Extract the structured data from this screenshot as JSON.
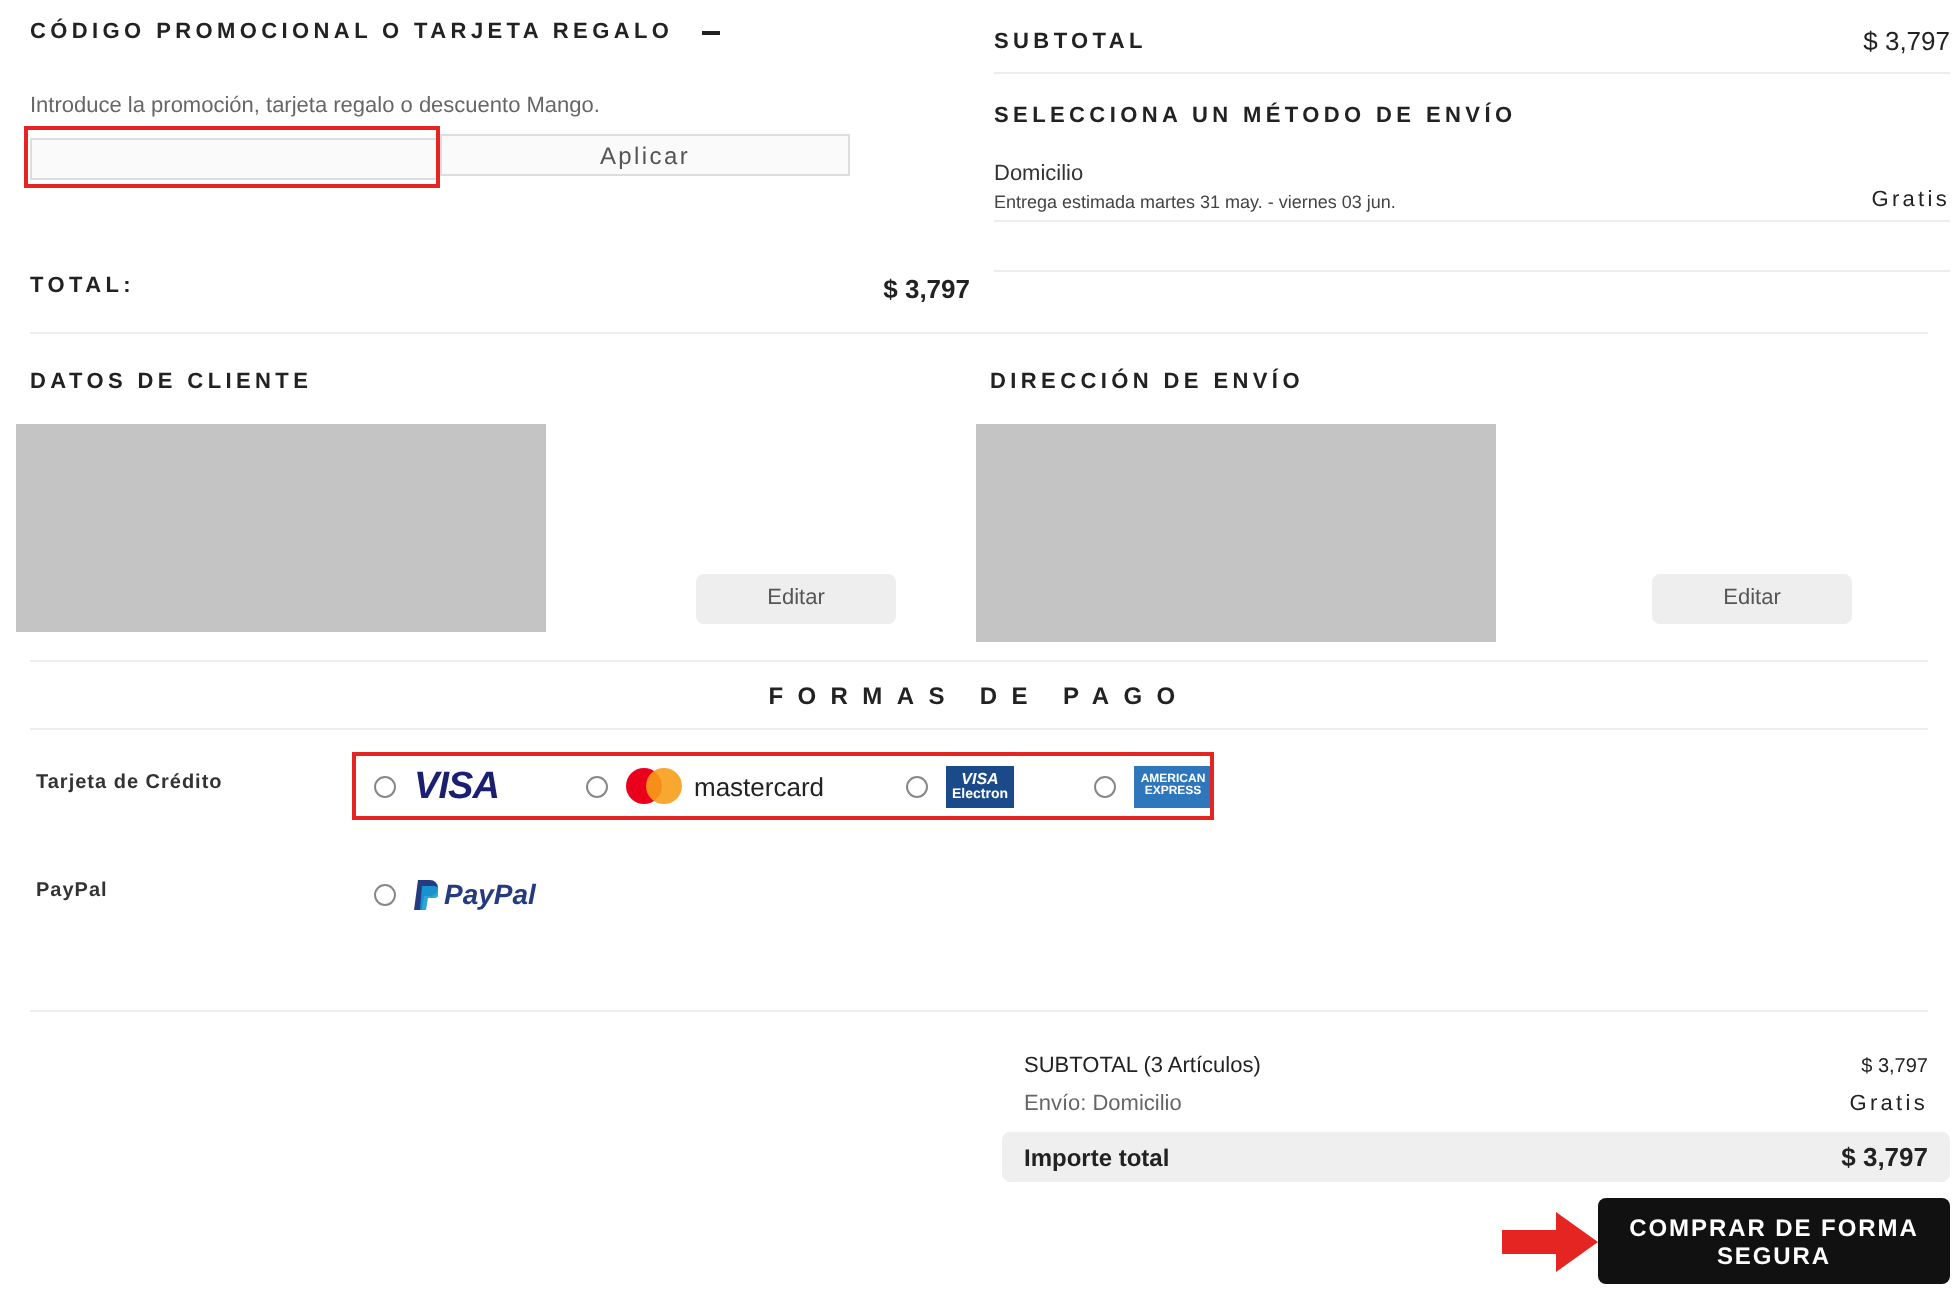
{
  "promo": {
    "title": "CÓDIGO PROMOCIONAL O TARJETA REGALO",
    "expanded": true,
    "hint": "Introduce la promoción, tarjeta regalo o descuento Mango.",
    "apply_button": "Aplicar"
  },
  "total": {
    "label": "TOTAL:",
    "value": "$ 3,797"
  },
  "subtotal": {
    "label": "SUBTOTAL",
    "value": "$ 3,797"
  },
  "shipping": {
    "title": "SELECCIONA UN MÉTODO DE ENVÍO",
    "options": [
      {
        "name": "Domicilio",
        "estimate": "Entrega estimada martes 31 may. - viernes 03 jun.",
        "price": "Gratis"
      }
    ]
  },
  "customer": {
    "title": "DATOS DE CLIENTE",
    "edit_button": "Editar"
  },
  "address": {
    "title": "DIRECCIÓN DE ENVÍO",
    "edit_button": "Editar"
  },
  "payment": {
    "title": "FORMAS DE PAGO",
    "methods": [
      {
        "label": "Tarjeta de Crédito",
        "options": [
          {
            "kind": "visa",
            "lines": [
              "VISA"
            ],
            "selected": false
          },
          {
            "kind": "mastercard",
            "lines": [
              "mastercard"
            ],
            "selected": false
          },
          {
            "kind": "visa_electron",
            "lines": [
              "VISA",
              "Electron"
            ],
            "selected": false
          },
          {
            "kind": "amex",
            "lines": [
              "AMERICAN",
              "EXPRESS"
            ],
            "selected": false
          }
        ]
      },
      {
        "label": "PayPal",
        "options": [
          {
            "kind": "paypal",
            "lines": [
              "PayPal"
            ],
            "selected": false
          }
        ]
      }
    ]
  },
  "summary": {
    "rows": [
      {
        "label": "SUBTOTAL (3 Artículos)",
        "value": "$ 3,797"
      },
      {
        "label": "Envío: Domicilio",
        "value": "Gratis"
      }
    ],
    "total_label": "Importe total",
    "total_value": "$ 3,797",
    "checkout_button": "COMPRAR DE FORMA SEGURA"
  }
}
